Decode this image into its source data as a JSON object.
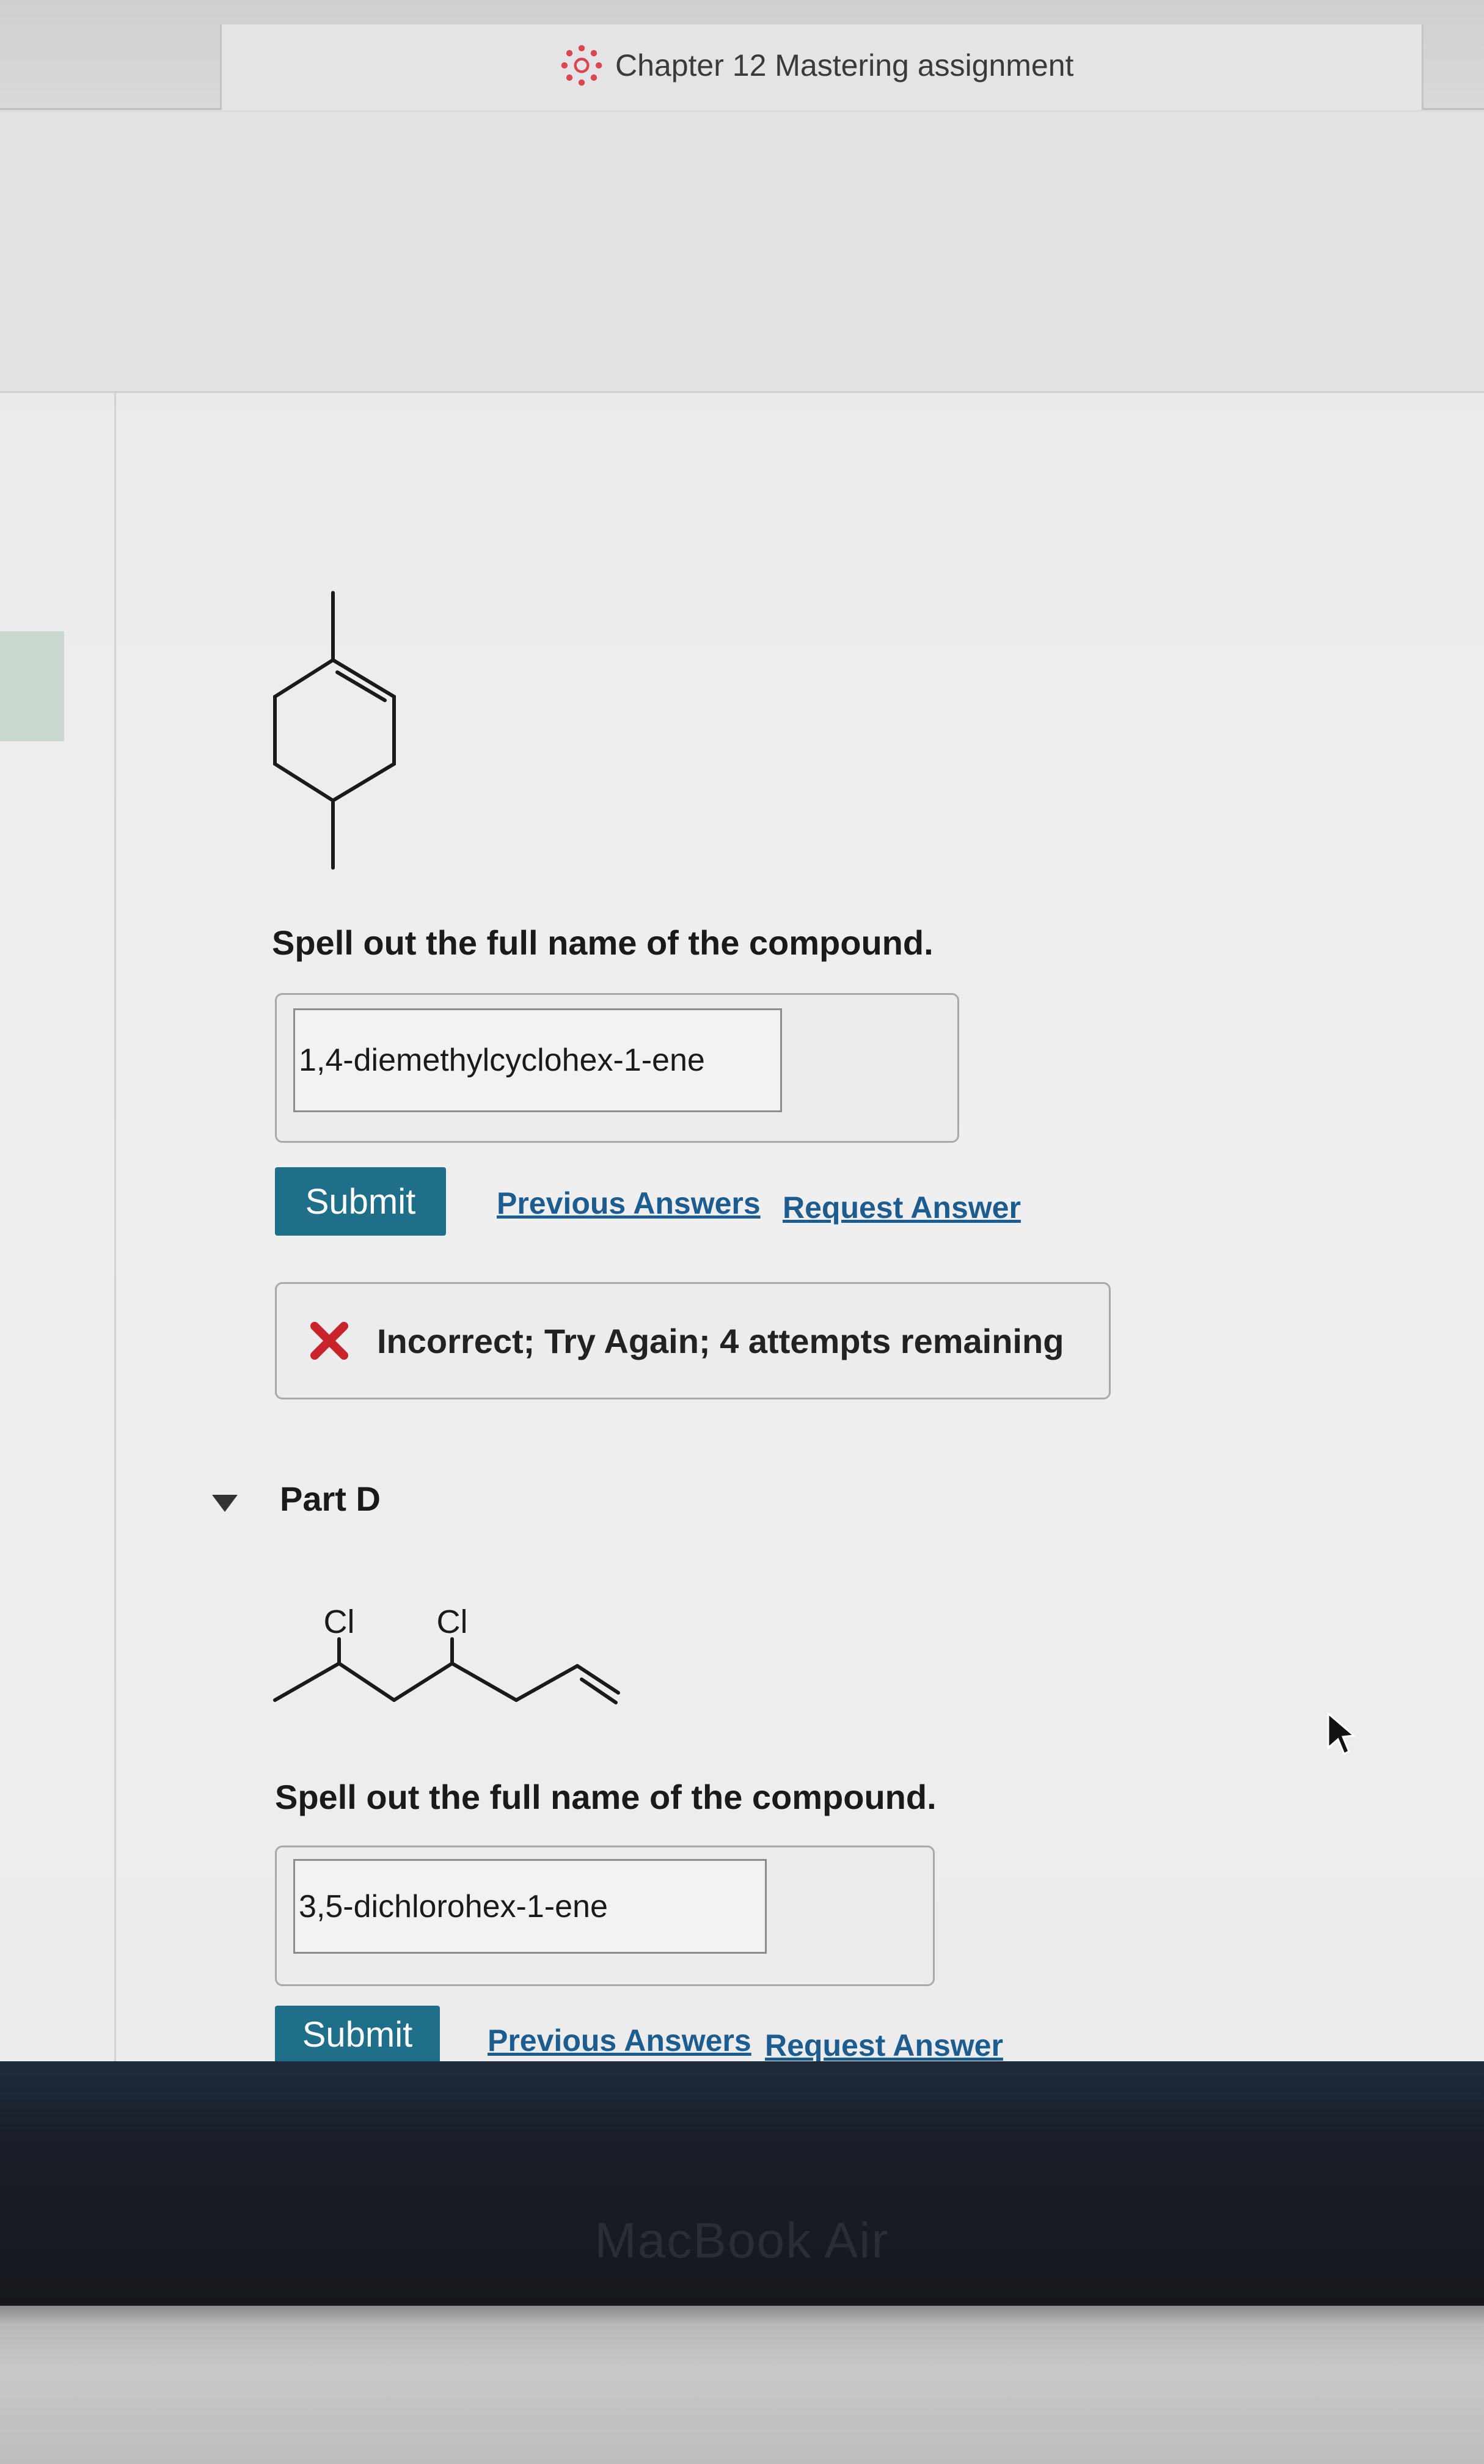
{
  "tab": {
    "title": "Chapter 12 Mastering assignment",
    "logo_icon": "canvas-logo-icon"
  },
  "partC": {
    "prompt": "Spell out the full name of the compound.",
    "answer_value": "1,4-diemethylcyclohex-1-ene",
    "submit_label": "Submit",
    "previous_answers_label": "Previous Answers",
    "request_answer_label": "Request Answer",
    "feedback_text": "Incorrect; Try Again; 4 attempts remaining",
    "feedback_icon": "x-icon"
  },
  "partD": {
    "label": "Part D",
    "structure_labels": [
      "Cl",
      "Cl"
    ],
    "prompt": "Spell out the full name of the compound.",
    "answer_value": "3,5-dichlorohex-1-ene",
    "submit_label": "Submit",
    "previous_answers_label": "Previous Answers",
    "request_answer_label": "Request Answer"
  },
  "device": {
    "brand": "MacBook Air"
  },
  "colors": {
    "submit_button": "#1f6f8b",
    "link": "#1d5c8e",
    "error_x": "#c8242b"
  }
}
